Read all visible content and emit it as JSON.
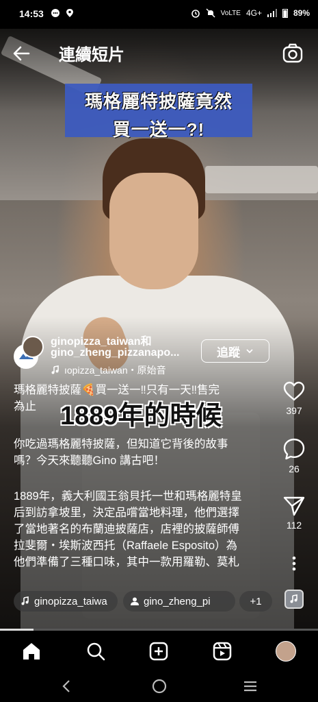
{
  "status_bar": {
    "time": "14:53",
    "network": "4G+",
    "battery": "89%"
  },
  "header": {
    "title": "連續短片"
  },
  "video": {
    "banner_line1": "瑪格麗特披薩竟然",
    "banner_line2": "買一送一?!",
    "overlay_subtitle": "1889年的時候"
  },
  "author": {
    "name_line1": "ginopizza_taiwan和",
    "name_line2": "gino_zheng_pizzanapo...",
    "follow_label": "追蹤",
    "audio_text": "ıopizza_taiwan・原始音"
  },
  "caption": {
    "line1": "瑪格麗特披薩🍕買一送一‼只有一天‼售完",
    "line2": "為止",
    "para2_line1": "你吃過瑪格麗特披薩，但知道它背後的故事",
    "para2_line2": "嗎？今天來聽聽Gino 講古吧！",
    "para3_line1": "1889年，義大利國王翁貝托一世和瑪格麗特皇",
    "para3_line2": "后到訪拿坡里，決定品嚐當地料理，他們選擇",
    "para3_line3": "了當地著名的布蘭迪披薩店，店裡的披薩師傅",
    "para3_line4": "拉斐爾・埃斯波西托（Raffaele Esposito）為",
    "para3_line5": "他們準備了三種口味，其中一款用羅勒、莫札"
  },
  "actions": {
    "likes": "397",
    "comments": "26",
    "shares": "112"
  },
  "chips": {
    "music": "ginopizza_taiwa",
    "collaborator": "gino_zheng_pi",
    "more": "+1"
  },
  "progress": {
    "fraction": 0.105
  },
  "colors": {
    "banner": "#3d5bbf",
    "background": "#000000"
  },
  "icons": [
    "back-arrow-icon",
    "camera-icon",
    "heart-icon",
    "comment-icon",
    "share-icon",
    "more-icon",
    "music-note-icon",
    "person-icon",
    "home-icon",
    "search-icon",
    "create-icon",
    "reels-icon"
  ]
}
